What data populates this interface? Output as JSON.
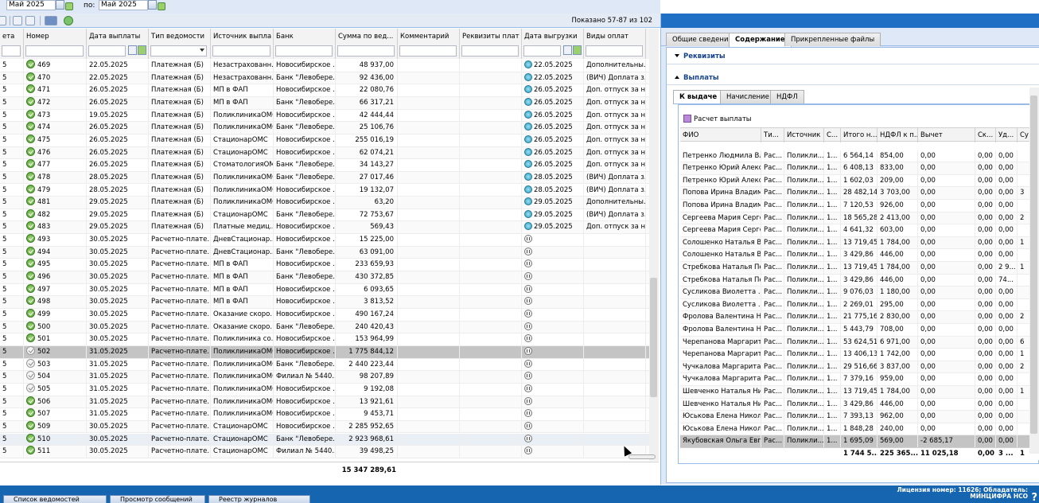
{
  "filter": {
    "date_from": "Май 2025",
    "to_label": "по:",
    "date_to": "Май 2025"
  },
  "status": {
    "shown": "Показано 57-87 из 102"
  },
  "grid": {
    "columns": [
      "ета",
      "Номер",
      "Дата выплаты",
      "Тип ведомости",
      "Источник выплат",
      "Банк",
      "Сумма по вед...",
      "Комментарий",
      "Реквизиты плат...",
      "Дата выгрузки",
      "Виды оплат"
    ],
    "rows": [
      {
        "c0": "5",
        "icon": "ok",
        "num": "469",
        "date": "22.05.2025",
        "type": "Платежная (Б)",
        "src": "Незастрахованн...",
        "bank": "Новосибирское ...",
        "sum": "48 937,00",
        "ul": "up",
        "udate": "22.05.2025",
        "kinds": "Дополнительны..."
      },
      {
        "c0": "5",
        "icon": "ok",
        "num": "470",
        "date": "22.05.2025",
        "type": "Платежная (Б)",
        "src": "Незастрахованн...",
        "bank": "Банк \"Левобере...",
        "sum": "92 436,00",
        "ul": "up",
        "udate": "22.05.2025",
        "kinds": "(ВИЧ) Доплата з..."
      },
      {
        "c0": "5",
        "icon": "ok",
        "num": "471",
        "date": "26.05.2025",
        "type": "Платежная (Б)",
        "src": "МП в ФАП",
        "bank": "Новосибирское ...",
        "sum": "22 080,76",
        "ul": "up",
        "udate": "26.05.2025",
        "kinds": "Доп. отпуск за н..."
      },
      {
        "c0": "5",
        "icon": "ok",
        "num": "472",
        "date": "26.05.2025",
        "type": "Платежная (Б)",
        "src": "МП в ФАП",
        "bank": "Банк \"Левобере...",
        "sum": "66 317,21",
        "ul": "up",
        "udate": "26.05.2025",
        "kinds": "Доп. отпуск за н..."
      },
      {
        "c0": "5",
        "icon": "ok",
        "num": "473",
        "date": "19.05.2025",
        "type": "Платежная (Б)",
        "src": "ПоликлиникаОМС",
        "bank": "Новосибирское ...",
        "sum": "42 444,44",
        "ul": "up",
        "udate": "26.05.2025",
        "kinds": "Доп. отпуск за н..."
      },
      {
        "c0": "5",
        "icon": "ok",
        "num": "474",
        "date": "26.05.2025",
        "type": "Платежная (Б)",
        "src": "ПоликлиникаОМС",
        "bank": "Банк \"Левобере...",
        "sum": "25 106,76",
        "ul": "up",
        "udate": "26.05.2025",
        "kinds": "Доп. отпуск за н..."
      },
      {
        "c0": "5",
        "icon": "ok",
        "num": "475",
        "date": "26.05.2025",
        "type": "Платежная (Б)",
        "src": "СтационарОМС",
        "bank": "Новосибирское ...",
        "sum": "255 016,19",
        "ul": "up",
        "udate": "26.05.2025",
        "kinds": "Доп. отпуск за н..."
      },
      {
        "c0": "5",
        "icon": "ok",
        "num": "476",
        "date": "26.05.2025",
        "type": "Платежная (Б)",
        "src": "СтационарОМС",
        "bank": "Новосибирское ...",
        "sum": "62 074,21",
        "ul": "up",
        "udate": "26.05.2025",
        "kinds": "Доп. отпуск за н..."
      },
      {
        "c0": "5",
        "icon": "ok",
        "num": "477",
        "date": "26.05.2025",
        "type": "Платежная (Б)",
        "src": "СтоматологияОМС",
        "bank": "Банк \"Левобере...",
        "sum": "34 143,27",
        "ul": "up",
        "udate": "26.05.2025",
        "kinds": "Доп. отпуск за н..."
      },
      {
        "c0": "5",
        "icon": "ok",
        "num": "478",
        "date": "28.05.2025",
        "type": "Платежная (Б)",
        "src": "ПоликлиникаОМС",
        "bank": "Банк \"Левобере...",
        "sum": "27 017,46",
        "ul": "up",
        "udate": "28.05.2025",
        "kinds": "(ВИЧ) Доплата з..."
      },
      {
        "c0": "5",
        "icon": "ok",
        "num": "479",
        "date": "28.05.2025",
        "type": "Платежная (Б)",
        "src": "ПоликлиникаОМС",
        "bank": "Новосибирское ...",
        "sum": "19 132,07",
        "ul": "up",
        "udate": "28.05.2025",
        "kinds": "(ВИЧ) Доплата з..."
      },
      {
        "c0": "5",
        "icon": "ok",
        "num": "481",
        "date": "29.05.2025",
        "type": "Платежная (Б)",
        "src": "ПоликлиникаОМС",
        "bank": "Новосибирское ...",
        "sum": "63,20",
        "ul": "up",
        "udate": "29.05.2025",
        "kinds": "Дополнительны..."
      },
      {
        "c0": "5",
        "icon": "ok",
        "num": "482",
        "date": "29.05.2025",
        "type": "Платежная (Б)",
        "src": "СтационарОМС",
        "bank": "Банк \"Левобере...",
        "sum": "72 753,67",
        "ul": "up",
        "udate": "29.05.2025",
        "kinds": "(ВИЧ) Доплата з..."
      },
      {
        "c0": "5",
        "icon": "ok",
        "num": "483",
        "date": "29.05.2025",
        "type": "Платежная (Б)",
        "src": "Платные медиц...",
        "bank": "Новосибирское ...",
        "sum": "569,43",
        "ul": "up",
        "udate": "29.05.2025",
        "kinds": "Доп. отпуск за н..."
      },
      {
        "c0": "5",
        "icon": "ok",
        "num": "493",
        "date": "30.05.2025",
        "type": "Расчетно-плате...",
        "src": "ДневСтационар...",
        "bank": "Новосибирское ...",
        "sum": "15 225,00",
        "ul": "pa",
        "udate": "",
        "kinds": ""
      },
      {
        "c0": "5",
        "icon": "ok",
        "num": "494",
        "date": "30.05.2025",
        "type": "Расчетно-плате...",
        "src": "ДневСтационар...",
        "bank": "Банк \"Левобере...",
        "sum": "63 091,00",
        "ul": "pa",
        "udate": "",
        "kinds": ""
      },
      {
        "c0": "5",
        "icon": "ok",
        "num": "495",
        "date": "30.05.2025",
        "type": "Расчетно-плате...",
        "src": "МП в ФАП",
        "bank": "Новосибирское ...",
        "sum": "233 659,93",
        "ul": "pa",
        "udate": "",
        "kinds": ""
      },
      {
        "c0": "5",
        "icon": "ok",
        "num": "496",
        "date": "30.05.2025",
        "type": "Расчетно-плате...",
        "src": "МП в ФАП",
        "bank": "Банк \"Левобере...",
        "sum": "430 372,85",
        "ul": "pa",
        "udate": "",
        "kinds": ""
      },
      {
        "c0": "5",
        "icon": "ok",
        "num": "497",
        "date": "30.05.2025",
        "type": "Расчетно-плате...",
        "src": "МП в ФАП",
        "bank": "Новосибирское ...",
        "sum": "6 093,65",
        "ul": "pa",
        "udate": "",
        "kinds": ""
      },
      {
        "c0": "5",
        "icon": "ok",
        "num": "498",
        "date": "30.05.2025",
        "type": "Расчетно-плате...",
        "src": "МП в ФАП",
        "bank": "Новосибирское ...",
        "sum": "3 813,52",
        "ul": "pa",
        "udate": "",
        "kinds": ""
      },
      {
        "c0": "5",
        "icon": "ok",
        "num": "499",
        "date": "30.05.2025",
        "type": "Расчетно-плате...",
        "src": "Оказание скоро...",
        "bank": "Новосибирское ...",
        "sum": "490 167,24",
        "ul": "pa",
        "udate": "",
        "kinds": ""
      },
      {
        "c0": "5",
        "icon": "ok",
        "num": "500",
        "date": "30.05.2025",
        "type": "Расчетно-плате...",
        "src": "Оказание скоро...",
        "bank": "Банк \"Левобере...",
        "sum": "240 420,43",
        "ul": "pa",
        "udate": "",
        "kinds": ""
      },
      {
        "c0": "5",
        "icon": "ok",
        "num": "501",
        "date": "30.05.2025",
        "type": "Расчетно-плате...",
        "src": "Поликлиника со...",
        "bank": "Новосибирское ...",
        "sum": "153 964,99",
        "ul": "pa",
        "udate": "",
        "kinds": ""
      },
      {
        "c0": "5",
        "icon": "un",
        "num": "502",
        "date": "31.05.2025",
        "type": "Расчетно-плате...",
        "src": "ПоликлиникаОМС",
        "bank": "Новосибирское ...",
        "sum": "1 775 844,12",
        "ul": "pa",
        "udate": "",
        "kinds": ""
      },
      {
        "c0": "5",
        "icon": "un",
        "num": "503",
        "date": "31.05.2025",
        "type": "Расчетно-плате...",
        "src": "ПоликлиникаОМС",
        "bank": "Банк \"Левобере...",
        "sum": "2 440 223,44",
        "ul": "pa",
        "udate": "",
        "kinds": ""
      },
      {
        "c0": "5",
        "icon": "un",
        "num": "504",
        "date": "31.05.2025",
        "type": "Расчетно-плате...",
        "src": "ПоликлиникаОМС",
        "bank": "Филиал № 5440...",
        "sum": "98 207,89",
        "ul": "pa",
        "udate": "",
        "kinds": ""
      },
      {
        "c0": "5",
        "icon": "un",
        "num": "505",
        "date": "31.05.2025",
        "type": "Расчетно-плате...",
        "src": "ПоликлиникаОМС",
        "bank": "Новосибирское ...",
        "sum": "9 192,08",
        "ul": "pa",
        "udate": "",
        "kinds": ""
      },
      {
        "c0": "5",
        "icon": "ok",
        "num": "506",
        "date": "31.05.2025",
        "type": "Расчетно-плате...",
        "src": "ПоликлиникаОМС",
        "bank": "Новосибирское ...",
        "sum": "13 921,61",
        "ul": "pa",
        "udate": "",
        "kinds": ""
      },
      {
        "c0": "5",
        "icon": "ok",
        "num": "507",
        "date": "31.05.2025",
        "type": "Расчетно-плате...",
        "src": "ПоликлиникаОМС",
        "bank": "Новосибирское ...",
        "sum": "9 453,71",
        "ul": "pa",
        "udate": "",
        "kinds": ""
      },
      {
        "c0": "5",
        "icon": "ok",
        "num": "509",
        "date": "30.05.2025",
        "type": "Расчетно-плате...",
        "src": "СтационарОМС",
        "bank": "Новосибирское ...",
        "sum": "2 285 952,65",
        "ul": "pa",
        "udate": "",
        "kinds": ""
      },
      {
        "c0": "5",
        "icon": "ok",
        "num": "510",
        "date": "30.05.2025",
        "type": "Расчетно-плате...",
        "src": "СтационарОМС",
        "bank": "Банк \"Левобере...",
        "sum": "2 923 968,61",
        "ul": "pa",
        "udate": "",
        "kinds": ""
      },
      {
        "c0": "5",
        "icon": "ok",
        "num": "511",
        "date": "30.05.2025",
        "type": "Расчетно-плате...",
        "src": "СтационарОМС",
        "bank": "Филиал № 5440...",
        "sum": "39 498,25",
        "ul": "pa",
        "udate": "",
        "kinds": ""
      }
    ],
    "total": "15 347 289,61"
  },
  "right": {
    "tabs": [
      "Общие сведения",
      "Содержание",
      "Прикрепленные файлы"
    ],
    "sect_req": "Реквизиты",
    "sect_pay": "Выплаты",
    "inner_tabs": [
      "К выдаче",
      "Начисление",
      "НДФЛ"
    ],
    "calc_btn": "Расчет выплаты",
    "columns": [
      "ФИО",
      "Ти...",
      "Источник",
      "С...",
      "Итого н...",
      "НДФЛ к п...",
      "Вычет",
      "Ск...",
      "Уд...",
      "Су"
    ],
    "rows": [
      [
        "Петренко Людмила Вл...",
        "Рас...",
        "Поликли...",
        "1...",
        "6 564,14",
        "854,00",
        "0,00",
        "0,00",
        "0,00",
        ""
      ],
      [
        "Петренко Юрий Алекс...",
        "Рас...",
        "Поликли...",
        "1...",
        "6 408,13",
        "833,00",
        "0,00",
        "0,00",
        "0,00",
        ""
      ],
      [
        "Петренко Юрий Алекс...",
        "Рас...",
        "Поликли...",
        "1...",
        "1 602,03",
        "209,00",
        "0,00",
        "0,00",
        "0,00",
        ""
      ],
      [
        "Попова Ирина Владим...",
        "Рас...",
        "Поликли...",
        "1...",
        "28 482,14",
        "3 703,00",
        "0,00",
        "0,00",
        "0,00",
        "3"
      ],
      [
        "Попова Ирина Владим...",
        "Рас...",
        "Поликли...",
        "1...",
        "7 120,53",
        "926,00",
        "0,00",
        "0,00",
        "0,00",
        ""
      ],
      [
        "Сергеева Мария Серге...",
        "Рас...",
        "Поликли...",
        "1...",
        "18 565,28",
        "2 413,00",
        "0,00",
        "0,00",
        "0,00",
        "2"
      ],
      [
        "Сергеева Мария Серге...",
        "Рас...",
        "Поликли...",
        "1...",
        "4 641,32",
        "603,00",
        "0,00",
        "0,00",
        "0,00",
        ""
      ],
      [
        "Солошенко Наталья В...",
        "Рас...",
        "Поликли...",
        "1...",
        "13 719,45",
        "1 784,00",
        "0,00",
        "0,00",
        "0,00",
        "1"
      ],
      [
        "Солошенко Наталья В...",
        "Рас...",
        "Поликли...",
        "1...",
        "3 429,86",
        "446,00",
        "0,00",
        "0,00",
        "0,00",
        ""
      ],
      [
        "Стребкова Наталья Пе...",
        "Рас...",
        "Поликли...",
        "1...",
        "13 719,45",
        "1 784,00",
        "0,00",
        "0,00",
        "2 9...",
        "1"
      ],
      [
        "Стребкова Наталья Пе...",
        "Рас...",
        "Поликли...",
        "1...",
        "3 429,86",
        "446,00",
        "0,00",
        "0,00",
        "74...",
        ""
      ],
      [
        "Сусликова Виолетта ...",
        "Рас...",
        "Поликли...",
        "1...",
        "9 076,03",
        "1 180,00",
        "0,00",
        "0,00",
        "0,00",
        ""
      ],
      [
        "Сусликова Виолетта ...",
        "Рас...",
        "Поликли...",
        "1...",
        "2 269,01",
        "295,00",
        "0,00",
        "0,00",
        "0,00",
        ""
      ],
      [
        "Фролова Валентина Н...",
        "Рас...",
        "Поликли...",
        "1...",
        "21 775,16",
        "2 830,00",
        "0,00",
        "0,00",
        "0,00",
        "2"
      ],
      [
        "Фролова Валентина Н...",
        "Рас...",
        "Поликли...",
        "1...",
        "5 443,79",
        "708,00",
        "0,00",
        "0,00",
        "0,00",
        ""
      ],
      [
        "Черепанова Маргарит...",
        "Рас...",
        "Поликли...",
        "1...",
        "53 624,51",
        "6 971,00",
        "0,00",
        "0,00",
        "0,00",
        "6"
      ],
      [
        "Черепанова Маргарит...",
        "Рас...",
        "Поликли...",
        "1...",
        "13 406,13",
        "1 742,00",
        "0,00",
        "0,00",
        "0,00",
        "1"
      ],
      [
        "Чучкалова Маргарита ...",
        "Рас...",
        "Поликли...",
        "1...",
        "29 516,66",
        "3 837,00",
        "0,00",
        "0,00",
        "0,00",
        "2"
      ],
      [
        "Чучкалова Маргарита ...",
        "Рас...",
        "Поликли...",
        "1...",
        "7 379,16",
        "959,00",
        "0,00",
        "0,00",
        "0,00",
        ""
      ],
      [
        "Шевченко Наталья Ни...",
        "Рас...",
        "Поликли...",
        "1...",
        "13 719,45",
        "1 784,00",
        "0,00",
        "0,00",
        "0,00",
        "1"
      ],
      [
        "Шевченко Наталья Ни...",
        "Рас...",
        "Поликли...",
        "1...",
        "3 429,86",
        "446,00",
        "0,00",
        "0,00",
        "0,00",
        ""
      ],
      [
        "Юськова Елена Никол...",
        "Рас...",
        "Поликли...",
        "1...",
        "7 393,13",
        "962,00",
        "0,00",
        "0,00",
        "0,00",
        ""
      ],
      [
        "Юськова Елена Никол...",
        "Рас...",
        "Поликли...",
        "1...",
        "1 848,28",
        "240,00",
        "0,00",
        "0,00",
        "0,00",
        ""
      ],
      [
        "Якубовская Ольга Евг...",
        "Рас...",
        "Поликли...",
        "1...",
        "1 695,09",
        "569,00",
        "-2 685,17",
        "0,00",
        "0,00",
        ""
      ]
    ],
    "totals": [
      "",
      "",
      "",
      "",
      "1 744 5...",
      "225 365...",
      "11 025,18",
      "0,00",
      "3 ...",
      "1"
    ]
  },
  "taskbar": {
    "tasks": [
      "Список ведомостей",
      "Просмотр сообщений",
      "Реестр журналов"
    ],
    "license_line1": "Лицензия номер: 11626; Обладатель:",
    "license_line2": "МИНЦИФРА НСО",
    "help": "?"
  }
}
